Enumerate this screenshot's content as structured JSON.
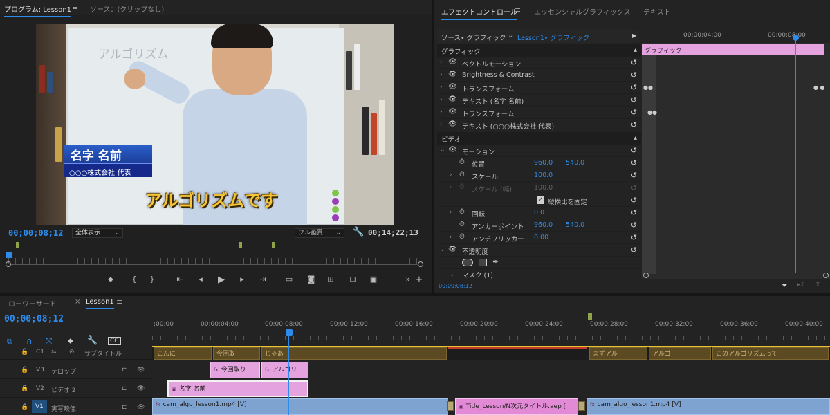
{
  "program": {
    "tab_label": "プログラム: Lesson1",
    "source_tab": "ソース：(クリップなし)",
    "timecode_current": "00;00;08;12",
    "zoom": "全体表示",
    "quality": "フル画質",
    "timecode_duration": "00;14;22;13"
  },
  "video": {
    "whiteboard_text": "アルゴリズム",
    "name_main": "名字 名前",
    "name_sub": "○○○株式会社 代表",
    "caption": "アルゴリズムです"
  },
  "effect_panel": {
    "tabs": [
      "エフェクトコントロール",
      "エッセンシャルグラフィックス",
      "テキスト"
    ],
    "source_label": "ソース• グラフィック",
    "sequence_label": "Lesson1• グラフィック",
    "graphic_section": "グラフィック",
    "rows": [
      {
        "label": "ベクトルモーション"
      },
      {
        "label": "Brightness & Contrast"
      },
      {
        "label": "トランスフォーム"
      },
      {
        "label": "テキスト (名字 名前)"
      },
      {
        "label": "トランスフォーム"
      },
      {
        "label": "テキスト (○○○株式会社 代表)"
      }
    ],
    "video_section": "ビデオ",
    "motion": "モーション",
    "position_label": "位置",
    "position_x": "960.0",
    "position_y": "540.0",
    "scale_label": "スケール",
    "scale_value": "100.0",
    "scale_w_label": "スケール (幅)",
    "scale_w_value": "100.0",
    "uniform_label": "縦横比を固定",
    "rotation_label": "回転",
    "rotation_value": "0.0",
    "anchor_label": "アンカーポイント",
    "anchor_x": "960.0",
    "anchor_y": "540.0",
    "flicker_label": "アンチフリッカー",
    "flicker_value": "0.00",
    "opacity_label": "不透明度",
    "mask_label": "マスク (1)",
    "bottom_timecode": "00;00;08;12",
    "mini_ruler": [
      "00;00;04;00",
      "00;00;08;00"
    ],
    "mini_clip_label": "グラフィック"
  },
  "timeline": {
    "tabs": [
      "ローワーサード",
      "Lesson1"
    ],
    "timecode": "00;00;08;12",
    "ruler": [
      ";00;00",
      "00;00;04;00",
      "00;00;08;00",
      "00;00;12;00",
      "00;00;16;00",
      "00;00;20;00",
      "00;00;24;00",
      "00;00;28;00",
      "00;00;32;00",
      "00;00;36;00",
      "00;00;40;00"
    ],
    "tracks": [
      {
        "id": "C1",
        "name": "サブタイトル"
      },
      {
        "id": "V3",
        "name": "テロップ"
      },
      {
        "id": "V2",
        "name": "ビデオ 2"
      },
      {
        "id": "V1",
        "name": "実写映像"
      }
    ],
    "subtitle_clips": [
      "こんに",
      "今回取",
      "じゃあ",
      "まずアル",
      "アルゴ",
      "このアルゴリズムって"
    ],
    "v3_clips": [
      "今回取り",
      "アルゴリ"
    ],
    "v2_clip": "名字 名前",
    "v1_clips": [
      "cam_algo_lesson1.mp4 [V]",
      "Title_Lesson/N次元タイトル.aep [",
      "cam_algo_lesson1.mp4 [V]"
    ]
  }
}
